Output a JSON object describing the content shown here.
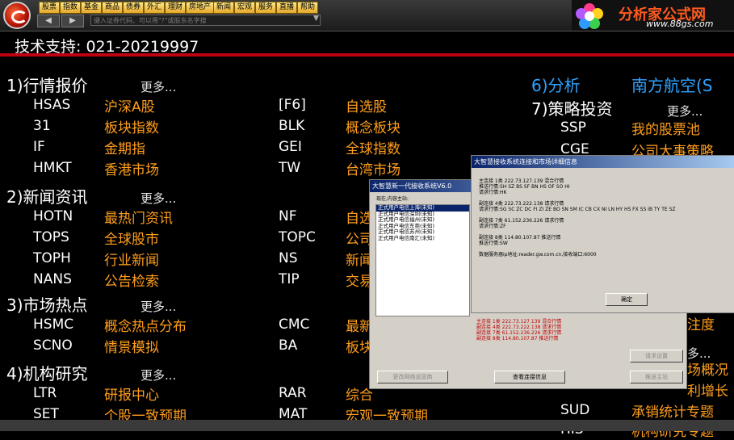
{
  "toolbar": {
    "buttons": [
      "股票",
      "指数",
      "基金",
      "商品",
      "债券",
      "外汇",
      "理财",
      "房地产",
      "新闻",
      "宏观",
      "服务",
      "直播",
      "帮助"
    ],
    "back_icon": "arrow-left-icon",
    "forward_icon": "arrow-right-icon",
    "search_placeholder": "键入证券代码、可以用\"?\"或股东名字搜"
  },
  "brand": {
    "name": "分析家公式网",
    "url": "www.88gs.com",
    "icon": "flower-logo-icon"
  },
  "support": "技术支持: 021-20219997",
  "colors": {
    "accent_red": "#c00010",
    "orange": "#ff9e1c",
    "blue": "#2fa3ff"
  },
  "more_label": "更多...",
  "sections": [
    {
      "title": "1)行情报价",
      "rows": [
        {
          "code": "HSAS",
          "name": "沪深A股"
        },
        {
          "code": "31",
          "name": "板块指数"
        },
        {
          "code": "IF",
          "name": "金期指"
        },
        {
          "code": "HMKT",
          "name": "香港市场"
        }
      ],
      "rows2": [
        {
          "code": "[F6]",
          "name": "自选股"
        },
        {
          "code": "BLK",
          "name": "概念板块"
        },
        {
          "code": "GEI",
          "name": "全球指数"
        },
        {
          "code": "TW",
          "name": "台湾市场"
        }
      ]
    },
    {
      "title": "2)新闻资讯",
      "rows": [
        {
          "code": "HOTN",
          "name": "最热门资讯"
        },
        {
          "code": "TOPS",
          "name": "全球股市"
        },
        {
          "code": "TOPH",
          "name": "行业新闻"
        },
        {
          "code": "NANS",
          "name": "公告检索"
        }
      ],
      "rows2": [
        {
          "code": "NF",
          "name": "自选"
        },
        {
          "code": "TOPC",
          "name": "公司"
        },
        {
          "code": "NS",
          "name": "新闻"
        },
        {
          "code": "TIP",
          "name": "交易"
        }
      ]
    },
    {
      "title": "3)市场热点",
      "rows": [
        {
          "code": "HSMC",
          "name": "概念热点分布"
        },
        {
          "code": "SCNO",
          "name": "情景模拟"
        }
      ],
      "rows2": [
        {
          "code": "CMC",
          "name": "最新"
        },
        {
          "code": "BA",
          "name": "板块"
        }
      ]
    },
    {
      "title": "4)机构研究",
      "rows": [
        {
          "code": "LTR",
          "name": "研报中心"
        },
        {
          "code": "SET",
          "name": "个股一致预期"
        }
      ],
      "rows2": [
        {
          "code": "RAR",
          "name": "综合"
        },
        {
          "code": "MAT",
          "name": "宏观一致预期"
        }
      ]
    }
  ],
  "right": {
    "sec6_title": "6)分析",
    "sec6_name": "南方航空(S",
    "sec7_title": "7)策略投资",
    "rows": [
      {
        "code": "SSP",
        "name": "我的股票池"
      },
      {
        "code": "CGE",
        "name": "公司大事策略"
      }
    ],
    "partial": [
      "注度",
      "多...",
      "场概况",
      "利增长"
    ],
    "bottom_rows": [
      {
        "code": "SUD",
        "name": "承销统计专题"
      },
      {
        "code": "HIS",
        "name": "机构研究专题"
      }
    ]
  },
  "dialog1": {
    "title": "大智慧新一代接收系统V6.0",
    "prompt": "现在,内容主站:",
    "list": [
      "正式用户电信上海(未知)",
      "正式用户电信深圳(未知)",
      "正式用户电信福州(未知)",
      "正式用户电信东莞(未知)",
      "正式用户电信苏州(未知)",
      "正式用户电信南汇(未知)"
    ],
    "red_lines": [
      "主连接 1类 222.73.127.139 混合行情",
      "副连接 4类 222.73.222.138 请求行情",
      "副连接 7类 61.152.236.226 请求行情",
      "副连接 8类 114.80.107.87 推送行情"
    ],
    "btn_change": "更改网络运营商",
    "btn_view": "查看连接信息",
    "btn_request": "请求设置",
    "btn_push": "推送主站"
  },
  "dialog2": {
    "title": "大智慧接收系统连接和市场详细信息",
    "lines": [
      "主连接 1类 222.73.127.139 混合行情",
      "推送行情:SH SZ BS SF BN HS OF SO HI",
      "请求行情:HK",
      "",
      "副连接 4类 222.73.222.138 请求行情",
      "请求行情:SG SC ZC DC FI ZI ZE BO SN SM IC CB CX NI LN HY HS FX SS IB TY TE SZ",
      "",
      "副连接 7类 61.152.236.226 请求行情",
      "请求行情:ZF",
      "",
      "副连接 8类 114.80.107.87 推送行情",
      "推送行情:SW",
      "",
      "数据服务器ip地址:reader.gw.com.cn,接收端口:6000"
    ],
    "ok_label": "确定"
  }
}
